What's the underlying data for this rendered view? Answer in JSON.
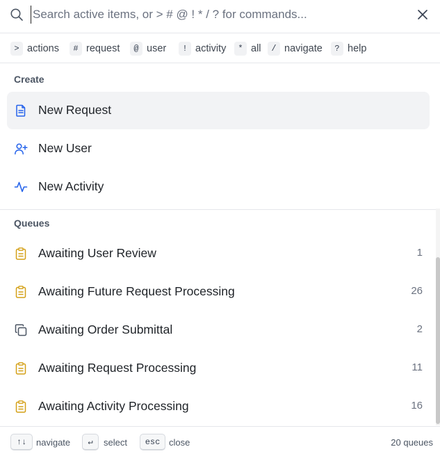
{
  "search": {
    "placeholder": "Search active items, or > # @ ! * / ? for commands...",
    "value": ""
  },
  "hints": [
    {
      "key": ">",
      "label": "actions"
    },
    {
      "key": "#",
      "label": "request"
    },
    {
      "key": "@",
      "label": "user"
    },
    {
      "key": "!",
      "label": "activity"
    },
    {
      "key": "*",
      "label": "all"
    },
    {
      "key": "/",
      "label": "navigate"
    },
    {
      "key": "?",
      "label": "help"
    }
  ],
  "create": {
    "title": "Create",
    "items": [
      {
        "label": "New Request",
        "icon": "document-icon"
      },
      {
        "label": "New User",
        "icon": "user-plus-icon"
      },
      {
        "label": "New Activity",
        "icon": "activity-pulse-icon"
      }
    ]
  },
  "queues": {
    "title": "Queues",
    "items": [
      {
        "label": "Awaiting User Review",
        "count": "1",
        "icon": "clipboard-icon"
      },
      {
        "label": "Awaiting Future Request Processing",
        "count": "26",
        "icon": "clipboard-icon"
      },
      {
        "label": "Awaiting Order Submittal",
        "count": "2",
        "icon": "copy-icon"
      },
      {
        "label": "Awaiting Request Processing",
        "count": "11",
        "icon": "clipboard-icon"
      },
      {
        "label": "Awaiting Activity Processing",
        "count": "16",
        "icon": "clipboard-icon"
      }
    ]
  },
  "footer": {
    "navigate_key": "↑↓",
    "navigate_label": "navigate",
    "select_key": "↵",
    "select_label": "select",
    "close_key": "esc",
    "close_label": "close",
    "queue_count": "20 queues"
  },
  "colors": {
    "accent_blue": "#2563eb",
    "queue_yellow": "#d4a017",
    "selected_bg": "#f2f3f5"
  }
}
